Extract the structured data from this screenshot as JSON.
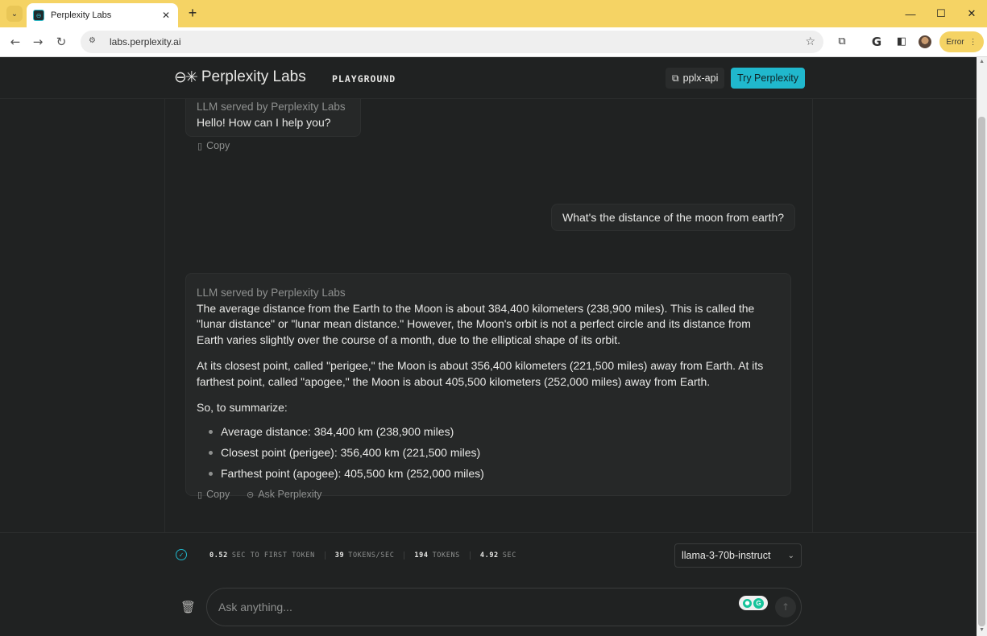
{
  "browser": {
    "tab_title": "Perplexity Labs",
    "url": "labs.perplexity.ai",
    "new_tab": "+",
    "error_label": "Error",
    "icons": [
      "tab-list-icon",
      "favicon-icon",
      "close-icon",
      "back-icon",
      "forward-icon",
      "reload-icon",
      "site-info-icon",
      "bookmark-star-icon",
      "extensions-icon",
      "google-icon",
      "side-panel-icon",
      "avatar",
      "more-icon"
    ]
  },
  "header": {
    "brand_logo": "⊖✳",
    "brand_name": "Perplexity Labs",
    "nav_playground": "PLAYGROUND",
    "api_button": "pplx-api",
    "try_button": "Try Perplexity"
  },
  "chat": {
    "bot_label": "LLM served by Perplexity Labs",
    "greeting": "Hello! How can I help you?",
    "copy_label": "Copy",
    "ask_label": "Ask Perplexity",
    "user_message": "What's the distance of the moon from earth?",
    "answer": {
      "p1": "The average distance from the Earth to the Moon is about 384,400 kilometers (238,900 miles). This is called the \"lunar distance\" or \"lunar mean distance.\" However, the Moon's orbit is not a perfect circle and its distance from Earth varies slightly over the course of a month, due to the elliptical shape of its orbit.",
      "p2": "At its closest point, called \"perigee,\" the Moon is about 356,400 kilometers (221,500 miles) away from Earth. At its farthest point, called \"apogee,\" the Moon is about 405,500 kilometers (252,000 miles) away from Earth.",
      "p3": "So, to summarize:",
      "bullets": [
        "Average distance: 384,400 km (238,900 miles)",
        "Closest point (perigee): 356,400 km (221,500 miles)",
        "Farthest point (apogee): 405,500 km (252,000 miles)"
      ]
    }
  },
  "stats": {
    "first_token_value": "0.52",
    "first_token_label": "SEC TO FIRST TOKEN",
    "tps_value": "39",
    "tps_label": "TOKENS/SEC",
    "tokens_value": "194",
    "tokens_label": "TOKENS",
    "sec_value": "4.92",
    "sec_label": "SEC"
  },
  "model_select": {
    "selected": "llama-3-70b-instruct"
  },
  "input": {
    "placeholder": "Ask anything..."
  },
  "colors": {
    "accent": "#20b8cd",
    "background": "#202222",
    "panel": "#262828",
    "chrome_tab_bar": "#f5d364"
  }
}
